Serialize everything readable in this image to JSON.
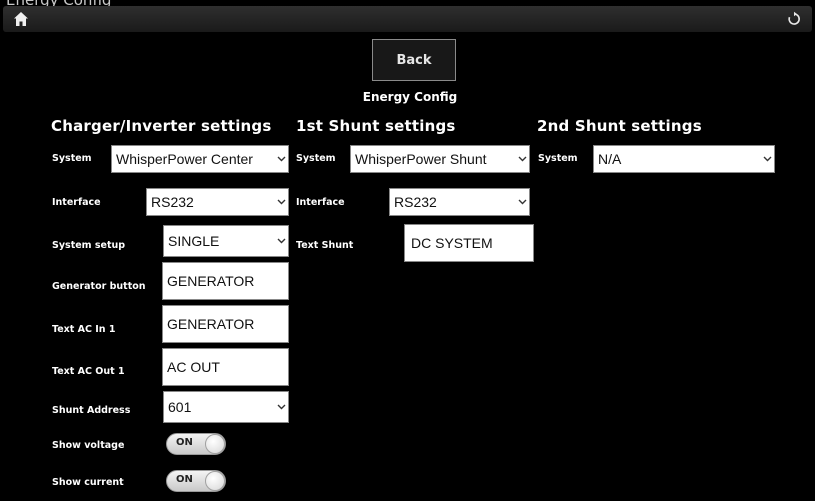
{
  "window": {
    "title": "Energy Config"
  },
  "topbar": {
    "home_icon": "home-icon",
    "refresh_icon": "refresh-icon"
  },
  "back_label": "Back",
  "page_title": "Energy Config",
  "sections": {
    "charger": {
      "heading": "Charger/Inverter settings",
      "system": {
        "label": "System",
        "value": "WhisperPower Center"
      },
      "interface": {
        "label": "Interface",
        "value": "RS232"
      },
      "system_setup": {
        "label": "System setup",
        "value": "SINGLE"
      },
      "generator_button": {
        "label": "Generator button",
        "value": "GENERATOR"
      },
      "text_ac_in": {
        "label": "Text AC In 1",
        "value": "GENERATOR"
      },
      "text_ac_out": {
        "label": "Text AC Out 1",
        "value": "AC OUT"
      },
      "shunt_address": {
        "label": "Shunt Address",
        "value": "601"
      },
      "show_voltage": {
        "label": "Show voltage",
        "state": "ON"
      },
      "show_current": {
        "label": "Show current",
        "state": "ON"
      }
    },
    "shunt1": {
      "heading": "1st Shunt settings",
      "system": {
        "label": "System",
        "value": "WhisperPower Shunt"
      },
      "interface": {
        "label": "Interface",
        "value": "RS232"
      },
      "text_shunt": {
        "label": "Text Shunt",
        "value": "DC SYSTEM"
      }
    },
    "shunt2": {
      "heading": "2nd Shunt settings",
      "system": {
        "label": "System",
        "value": "N/A"
      }
    }
  },
  "colors": {
    "background": "#000000",
    "field_bg": "#ffffff",
    "text": "#ffffff"
  }
}
